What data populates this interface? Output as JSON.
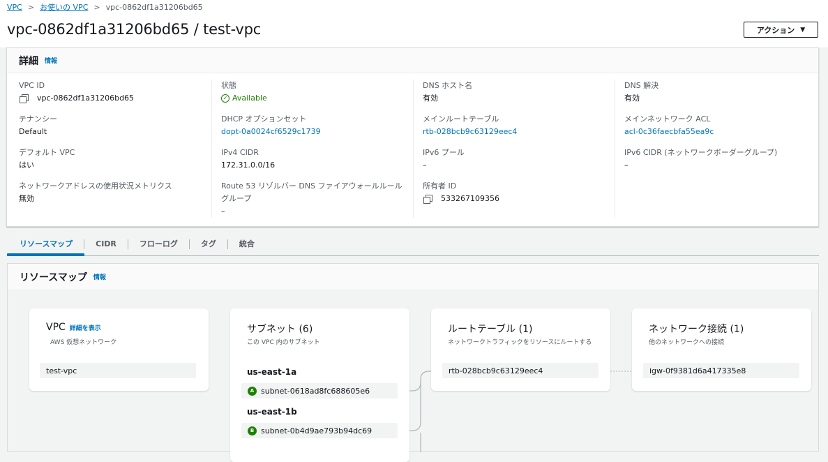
{
  "breadcrumb": {
    "root": "VPC",
    "parent": "お使いの VPC",
    "current": "vpc-0862df1a31206bd65"
  },
  "page_title": "vpc-0862df1a31206bd65 / test-vpc",
  "action_button": "アクション",
  "details": {
    "title": "詳細",
    "info": "情報",
    "vpc_id": {
      "label": "VPC ID",
      "value": "vpc-0862df1a31206bd65"
    },
    "tenancy": {
      "label": "テナンシー",
      "value": "Default"
    },
    "default_vpc": {
      "label": "デフォルト VPC",
      "value": "はい"
    },
    "ip_metrics": {
      "label": "ネットワークアドレスの使用状況メトリクス",
      "value": "無効"
    },
    "state": {
      "label": "状態",
      "value": "Available"
    },
    "dhcp": {
      "label": "DHCP オプションセット",
      "value": "dopt-0a0024cf6529c1739"
    },
    "ipv4_cidr": {
      "label": "IPv4 CIDR",
      "value": "172.31.0.0/16"
    },
    "route53": {
      "label_line1": "Route 53 リゾルバー DNS ファイアウォールルール",
      "label_line2": "グループ",
      "value": "–"
    },
    "dns_hostnames": {
      "label": "DNS ホスト名",
      "value": "有効"
    },
    "main_route_table": {
      "label": "メインルートテーブル",
      "value": "rtb-028bcb9c63129eec4"
    },
    "ipv6_pool": {
      "label": "IPv6 プール",
      "value": "–"
    },
    "owner_id": {
      "label": "所有者 ID",
      "value": "533267109356"
    },
    "dns_resolution": {
      "label": "DNS 解決",
      "value": "有効"
    },
    "main_acl": {
      "label": "メインネットワーク ACL",
      "value": "acl-0c36faecbfa55ea9c"
    },
    "ipv6_cidr": {
      "label": "IPv6 CIDR (ネットワークボーダーグループ)",
      "value": "–"
    }
  },
  "tabs": [
    "リソースマップ",
    "CIDR",
    "フローログ",
    "タグ",
    "統合"
  ],
  "resource_map": {
    "title": "リソースマップ",
    "info": "情報",
    "vpc_card": {
      "title": "VPC",
      "detail_link": "詳細を表示",
      "subtitle": "AWS 仮想ネットワーク",
      "item": "test-vpc"
    },
    "subnet_card": {
      "title": "サブネット (6)",
      "subtitle": "この VPC 内のサブネット",
      "groups": [
        {
          "az": "us-east-1a",
          "badge": "A",
          "subnet": "subnet-0618ad8fc688605e6"
        },
        {
          "az": "us-east-1b",
          "badge": "B",
          "subnet": "subnet-0b4d9ae793b94dc69"
        }
      ]
    },
    "route_card": {
      "title": "ルートテーブル (1)",
      "subtitle": "ネットワークトラフィックをリソースにルートする",
      "item": "rtb-028bcb9c63129eec4"
    },
    "network_card": {
      "title": "ネットワーク接続 (1)",
      "subtitle": "他のネットワークへの接続",
      "item": "igw-0f9381d6a417335e8"
    }
  },
  "colors": {
    "link": "#0073bb",
    "success": "#1d8102",
    "border": "#d5dbdb"
  }
}
